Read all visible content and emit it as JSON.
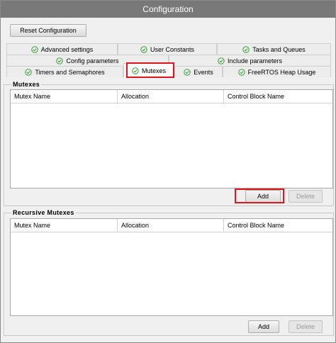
{
  "window": {
    "title": "Configuration"
  },
  "toolbar": {
    "reset_label": "Reset Configuration"
  },
  "tabs": {
    "row1": [
      "Advanced settings",
      "User Constants",
      "Tasks and Queues"
    ],
    "row2": [
      "Config parameters",
      "Include parameters"
    ],
    "row3": [
      "Timers and Semaphores",
      "Mutexes",
      "Events",
      "FreeRTOS Heap Usage"
    ],
    "active": "Mutexes"
  },
  "mutexes": {
    "title": "Mutexes",
    "columns": [
      "Mutex Name",
      "Allocation",
      "Control Block Name"
    ],
    "rows": [],
    "add_label": "Add",
    "delete_label": "Delete"
  },
  "recursive_mutexes": {
    "title": "Recursive Mutexes",
    "columns": [
      "Mutex Name",
      "Allocation",
      "Control Block Name"
    ],
    "rows": [],
    "add_label": "Add",
    "delete_label": "Delete"
  },
  "colors": {
    "titlebar": "#797979",
    "check_green": "#3aa03a",
    "highlight_red": "#e0141e"
  }
}
